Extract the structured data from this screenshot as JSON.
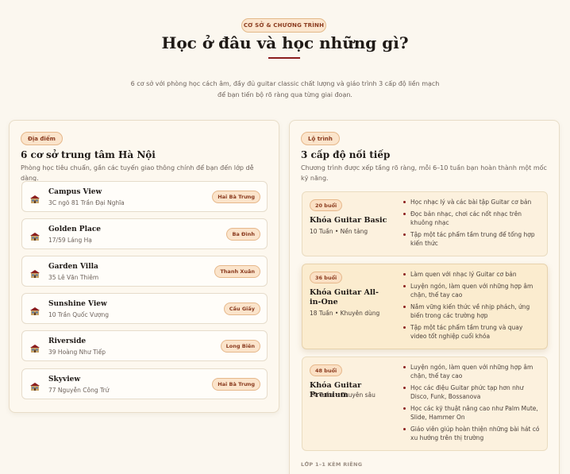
{
  "header": {
    "badge": "CƠ SỞ & CHƯƠNG TRÌNH",
    "title": "Học ở đâu và học những gì?",
    "subtitle": "6 cơ sở với phòng học cách âm, đầy đủ guitar classic chất lượng và giáo trình 3 cấp độ liền mạch để bạn tiến bộ rõ ràng qua từng giai đoạn.",
    "accent_color": "#8b1d1d"
  },
  "locations_card": {
    "pill": "Địa điểm",
    "title": "6 cơ sở trung tâm Hà Nội",
    "description": "Phòng học tiêu chuẩn, gần các tuyến giao thông chính để bạn đến lớp dễ dàng.",
    "icon": "school-building-icon",
    "items": [
      {
        "name": "Campus View",
        "address": "3C ngõ 81 Trần Đại Nghĩa",
        "district": "Hai Bà Trưng"
      },
      {
        "name": "Golden Place",
        "address": "17/59 Láng Hạ",
        "district": "Ba Đình"
      },
      {
        "name": "Garden Villa",
        "address": "35 Lê Văn Thiêm",
        "district": "Thanh Xuân"
      },
      {
        "name": "Sunshine View",
        "address": "10 Trần Quốc Vượng",
        "district": "Cầu Giấy"
      },
      {
        "name": "Riverside",
        "address": "39 Hoàng Như Tiếp",
        "district": "Long Biên"
      },
      {
        "name": "Skyview",
        "address": "77 Nguyễn Công Trứ",
        "district": "Hai Bà Trưng"
      }
    ]
  },
  "levels_card": {
    "pill": "Lộ trình",
    "title": "3 cấp độ nối tiếp",
    "description": "Chương trình được xếp tầng rõ ràng, mỗi 6–10 tuần bạn hoàn thành một mốc kỹ năng.",
    "levels": [
      {
        "sessions": "20 buổi",
        "name": "Khóa Guitar Basic",
        "meta": "10 Tuần • Nền tảng",
        "points": [
          "Học nhạc lý và các bài tập Guitar cơ bản",
          "Đọc bản nhạc, chơi các nốt nhạc trên khuông nhạc",
          "Tập một tác phẩm tầm trung để tổng hợp kiến thức"
        ]
      },
      {
        "sessions": "36 buổi",
        "name": "Khóa Guitar All-in-One",
        "meta": "18 Tuần • Khuyên dùng",
        "points": [
          "Làm quen với nhạc lý Guitar cơ bản",
          "Luyện ngón, làm quen với những hợp âm chặn, thế tay cao",
          "Nắm vững kiến thức về nhịp phách, ứng biến trong các trường hợp",
          "Tập một tác phẩm tầm trung và quay video tốt nghiệp cuối khóa"
        ]
      },
      {
        "sessions": "48 buổi",
        "name": "Khóa Guitar Premium",
        "meta": "24 Tuần • Chuyên sâu",
        "points": [
          "Luyện ngón, làm quen với những hợp âm chặn, thế tay cao",
          "Học các điệu Guitar phức tạp hơn như Disco, Funk, Bossanova",
          "Học các kỹ thuật nâng cao như Palm Mute, Slide, Hammer On",
          "Giáo viên giúp hoàn thiện những bài hát có xu hướng trên thị trường"
        ]
      }
    ],
    "footnote": "LỚP 1–1 KÈM RIÊNG"
  }
}
